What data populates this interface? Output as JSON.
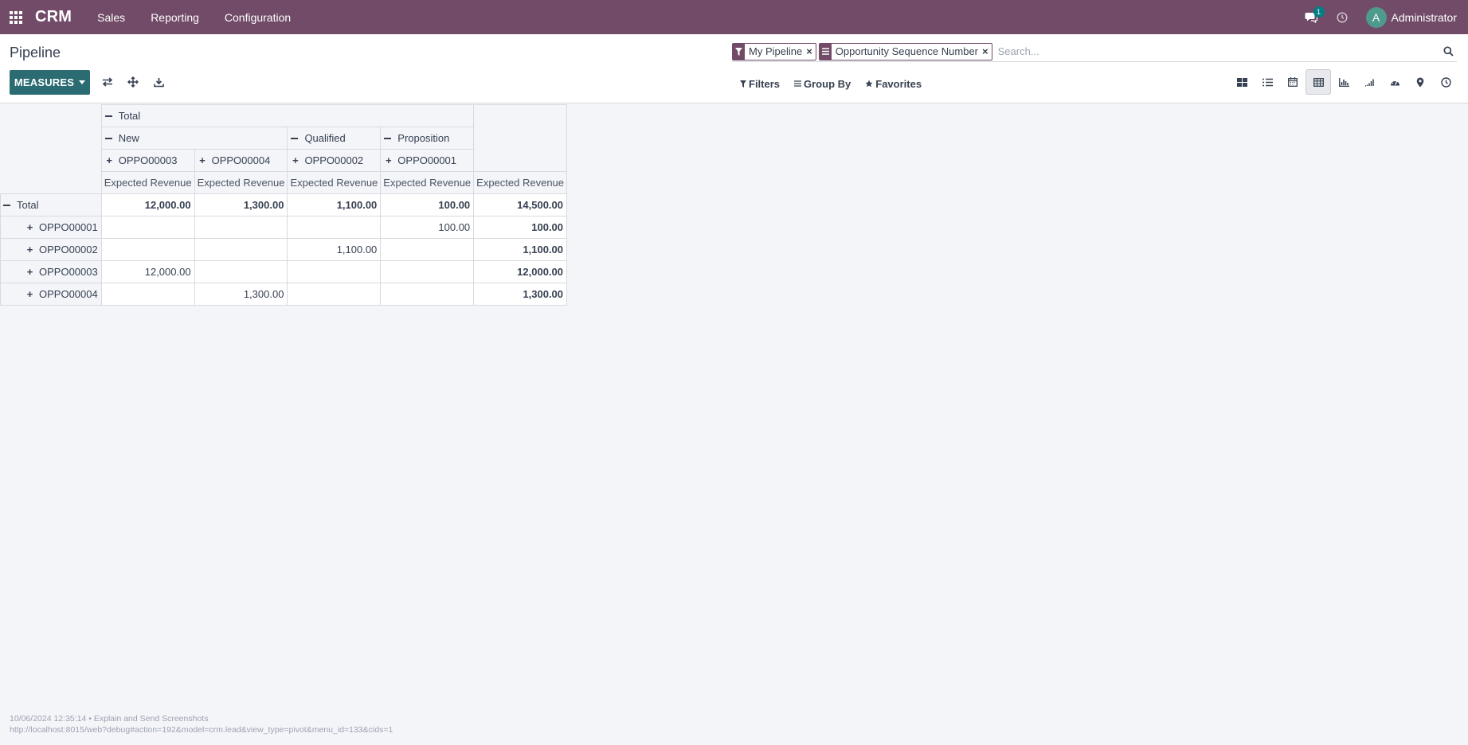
{
  "navbar": {
    "brand": "CRM",
    "menu": [
      "Sales",
      "Reporting",
      "Configuration"
    ],
    "chat_count": "1",
    "avatar_letter": "A",
    "user": "Administrator"
  },
  "control": {
    "title": "Pipeline",
    "measures_label": "MEASURES",
    "search": {
      "facets": [
        "My Pipeline",
        "Opportunity Sequence Number"
      ],
      "placeholder": "Search..."
    },
    "filters": [
      "Filters",
      "Group By",
      "Favorites"
    ],
    "views": [
      "kanban-icon",
      "list-icon",
      "calendar-icon",
      "pivot-icon",
      "graph-icon",
      "cohort-icon",
      "dashboard-icon",
      "map-icon",
      "activity-icon"
    ],
    "active_view": "pivot-icon"
  },
  "pivot": {
    "col_total": "Total",
    "stages": [
      "New",
      "Qualified",
      "Proposition"
    ],
    "opportunities": [
      "OPPO00003",
      "OPPO00004",
      "OPPO00002",
      "OPPO00001"
    ],
    "measure": "Expected Revenue",
    "row_total_label": "Total",
    "totals": [
      "12,000.00",
      "1,300.00",
      "1,100.00",
      "100.00",
      "14,500.00"
    ],
    "rows": [
      {
        "label": "OPPO00001",
        "cells": [
          "",
          "",
          "",
          "100.00",
          "100.00"
        ]
      },
      {
        "label": "OPPO00002",
        "cells": [
          "",
          "",
          "1,100.00",
          "",
          "1,100.00"
        ]
      },
      {
        "label": "OPPO00003",
        "cells": [
          "12,000.00",
          "",
          "",
          "",
          "12,000.00"
        ]
      },
      {
        "label": "OPPO00004",
        "cells": [
          "",
          "1,300.00",
          "",
          "",
          "1,300.00"
        ]
      }
    ]
  },
  "footer": {
    "line1": "10/06/2024 12:35:14 • Explain and Send Screenshots",
    "line2": "http://localhost:8015/web?debug#action=192&model=crm.lead&view_type=pivot&menu_id=133&cids=1"
  }
}
